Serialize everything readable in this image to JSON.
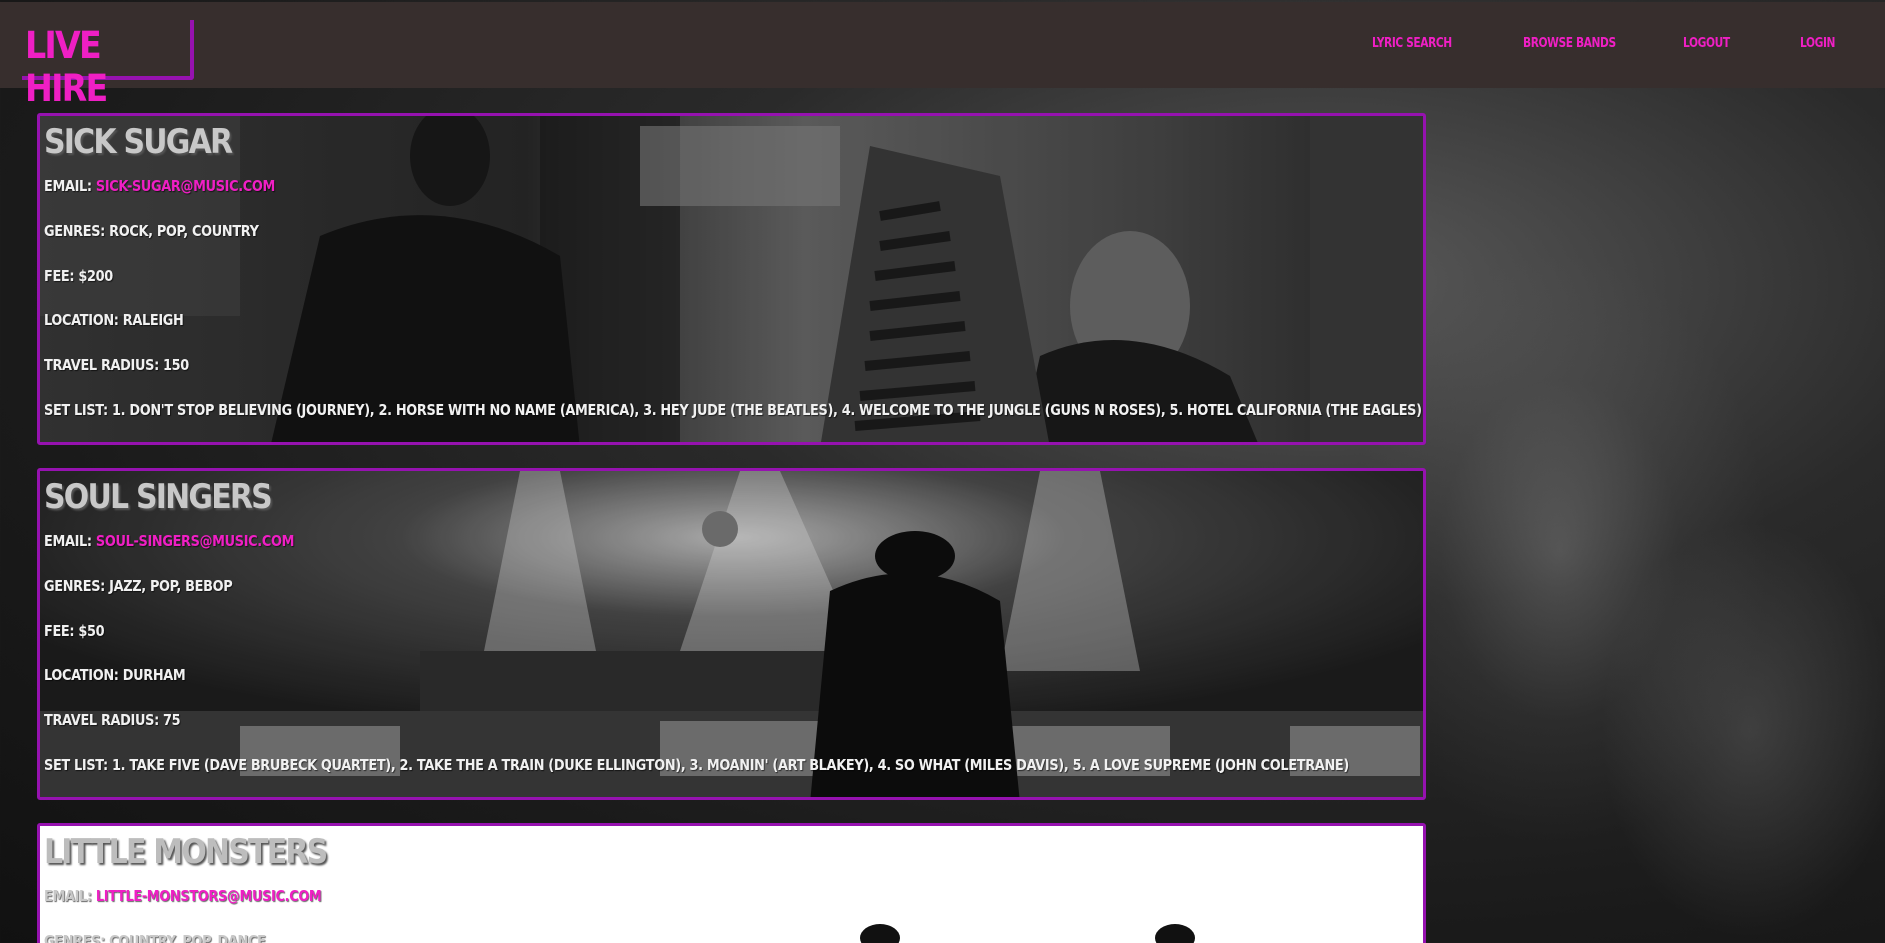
{
  "header": {
    "logo": "LIVE HIRE",
    "nav": [
      {
        "label": "LYRIC SEARCH"
      },
      {
        "label": "BROWSE BANDS"
      },
      {
        "label": "LOGOUT"
      },
      {
        "label": "LOGIN"
      }
    ]
  },
  "bands": [
    {
      "name": "SICK SUGAR",
      "email_label": "EMAIL:",
      "email": "SICK-SUGAR@MUSIC.COM",
      "genres": "GENRES: ROCK, POP, COUNTRY",
      "fee": "FEE: $200",
      "location": "LOCATION: RALEIGH",
      "radius": "TRAVEL RADIUS: 150",
      "setlist": "SET LIST: 1. DON'T STOP BELIEVING (JOURNEY), 2. HORSE WITH NO NAME (AMERICA), 3. HEY JUDE (THE BEATLES), 4. WELCOME TO THE JUNGLE (GUNS N ROSES), 5. HOTEL CALIFORNIA (THE EAGLES)"
    },
    {
      "name": "SOUL SINGERS",
      "email_label": "EMAIL:",
      "email": "SOUL-SINGERS@MUSIC.COM",
      "genres": "GENRES: JAZZ, POP, BEBOP",
      "fee": "FEE: $50",
      "location": "LOCATION: DURHAM",
      "radius": "TRAVEL RADIUS: 75",
      "setlist": "SET LIST: 1. TAKE FIVE (DAVE BRUBECK QUARTET), 2. TAKE THE A TRAIN (DUKE ELLINGTON), 3. MOANIN' (ART BLAKEY), 4. SO WHAT (MILES DAVIS), 5. A LOVE SUPREME (JOHN COLETRANE)"
    },
    {
      "name": "LITTLE MONSTERS",
      "email_label": "EMAIL:",
      "email": "LITTLE-MONSTORS@MUSIC.COM",
      "genres": "GENRES: COUNTRY, POP, DANCE"
    }
  ],
  "colors": {
    "accent": "#ef1fc4",
    "border": "#9612b0",
    "header_bg": "#372e2d"
  }
}
